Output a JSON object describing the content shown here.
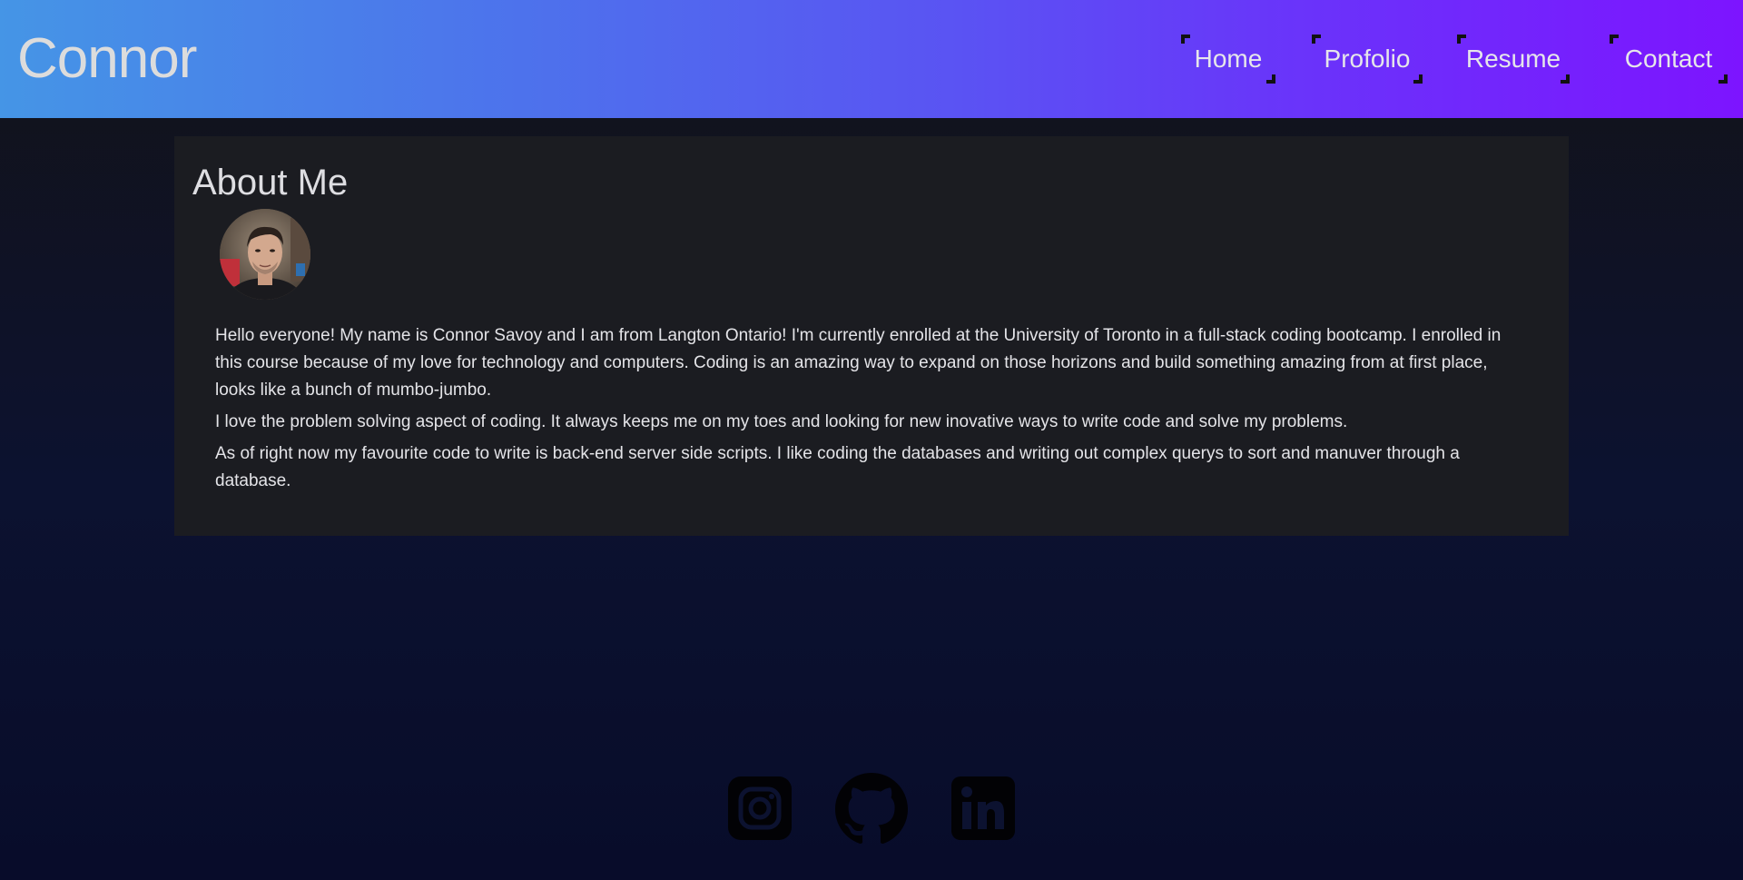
{
  "header": {
    "brand": "Connor",
    "nav": [
      {
        "label": "Home"
      },
      {
        "label": "Profolio"
      },
      {
        "label": "Resume"
      },
      {
        "label": "Contact"
      }
    ]
  },
  "about": {
    "title": "About Me",
    "paragraphs": [
      "Hello everyone! My name is Connor Savoy and I am from Langton Ontario! I'm currently enrolled at the University of Toronto in a full-stack coding bootcamp. I enrolled in this course because of my love for technology and computers. Coding is an amazing way to expand on those horizons and build something amazing from at first place, looks like a bunch of mumbo-jumbo.",
      "I love the problem solving aspect of coding. It always keeps me on my toes and looking for new inovative ways to write code and solve my problems.",
      "As of right now my favourite code to write is back-end server side scripts. I like coding the databases and writing out complex querys to sort and manuver through a database."
    ]
  },
  "footer": {
    "socials": [
      {
        "icon": "instagram-icon"
      },
      {
        "icon": "github-icon"
      },
      {
        "icon": "linkedin-icon"
      }
    ]
  },
  "colors": {
    "header_gradient_start": "#4595e6",
    "header_gradient_end": "#7d14ff",
    "card_background": "#1b1c21",
    "page_background": "#0c1230"
  }
}
